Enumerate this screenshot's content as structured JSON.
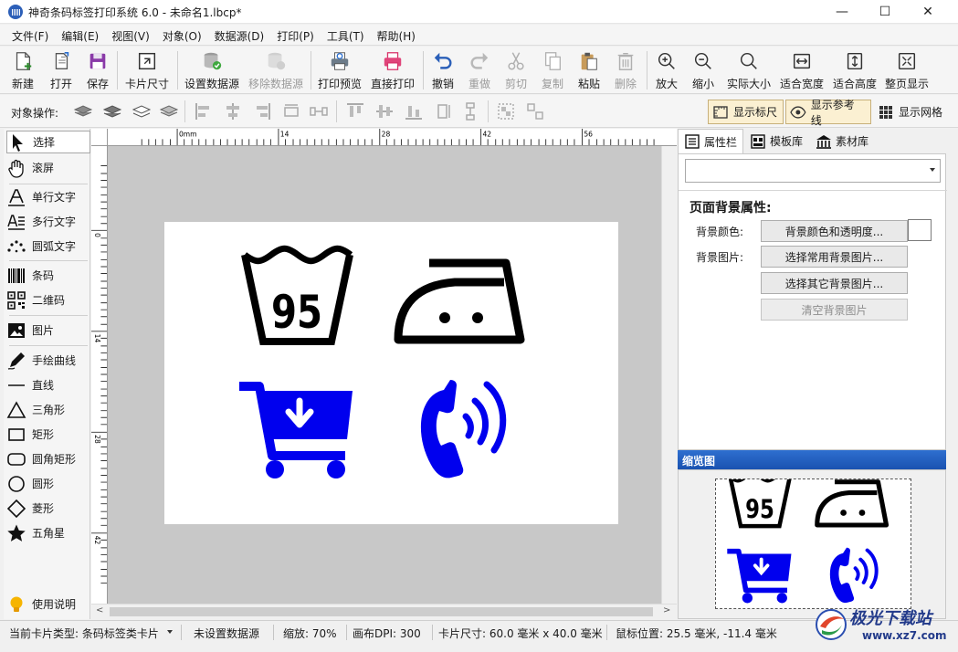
{
  "window": {
    "title": "神奇条码标签打印系统 6.0 - 未命名1.lbcp*",
    "minimize": "—",
    "maximize": "☐",
    "close": "✕"
  },
  "menu": [
    "文件(F)",
    "编辑(E)",
    "视图(V)",
    "对象(O)",
    "数据源(D)",
    "打印(P)",
    "工具(T)",
    "帮助(H)"
  ],
  "toolbar": {
    "new": "新建",
    "open": "打开",
    "save": "保存",
    "card_size": "卡片尺寸",
    "set_datasource": "设置数据源",
    "remove_datasource": "移除数据源",
    "print_preview": "打印预览",
    "direct_print": "直接打印",
    "undo": "撤销",
    "redo": "重做",
    "cut": "剪切",
    "copy": "复制",
    "paste": "粘贴",
    "delete": "删除",
    "zoom_in": "放大",
    "zoom_out": "缩小",
    "actual_size": "实际大小",
    "fit_width": "适合宽度",
    "fit_height": "适合高度",
    "full_page": "整页显示"
  },
  "objbar": {
    "label": "对象操作:",
    "show_ruler": "显示标尺",
    "show_guides": "显示参考线",
    "show_grid": "显示网格"
  },
  "tools": {
    "select": "选择",
    "pan": "滚屏",
    "single_text": "单行文字",
    "multi_text": "多行文字",
    "arc_text": "圆弧文字",
    "barcode": "条码",
    "qrcode": "二维码",
    "image": "图片",
    "freehand": "手绘曲线",
    "line": "直线",
    "triangle": "三角形",
    "rect": "矩形",
    "rounded_rect": "圆角矩形",
    "circle": "圆形",
    "diamond": "菱形",
    "star": "五角星",
    "help": "使用说明"
  },
  "ruler": {
    "h_labels": [
      "0mm",
      "14",
      "28",
      "42",
      "56"
    ],
    "v_labels": [
      "0",
      "14",
      "28",
      "42"
    ]
  },
  "card": {
    "wash_number": "95"
  },
  "panel": {
    "tabs": [
      "属性栏",
      "模板库",
      "素材库"
    ],
    "section_title": "页面背景属性:",
    "bg_color_label": "背景颜色:",
    "bg_color_btn": "背景颜色和透明度...",
    "bg_image_label": "背景图片:",
    "bg_common_btn": "选择常用背景图片...",
    "bg_other_btn": "选择其它背景图片...",
    "bg_clear_btn": "清空背景图片",
    "thumb_title": "缩览图"
  },
  "status": {
    "card_type": "当前卡片类型: 条码标签类卡片",
    "datasource": "未设置数据源",
    "zoom": "缩放: 70%",
    "dpi": "画布DPI: 300",
    "card_size": "卡片尺寸: 60.0 毫米 x 40.0 毫米",
    "mouse": "鼠标位置: 25.5 毫米, -11.4 毫米"
  },
  "watermark": {
    "name": "极光下载站",
    "url": "www.xz7.com"
  },
  "colors": {
    "accent_blue": "#0000ee",
    "thumb_header": "#1a52b0"
  }
}
